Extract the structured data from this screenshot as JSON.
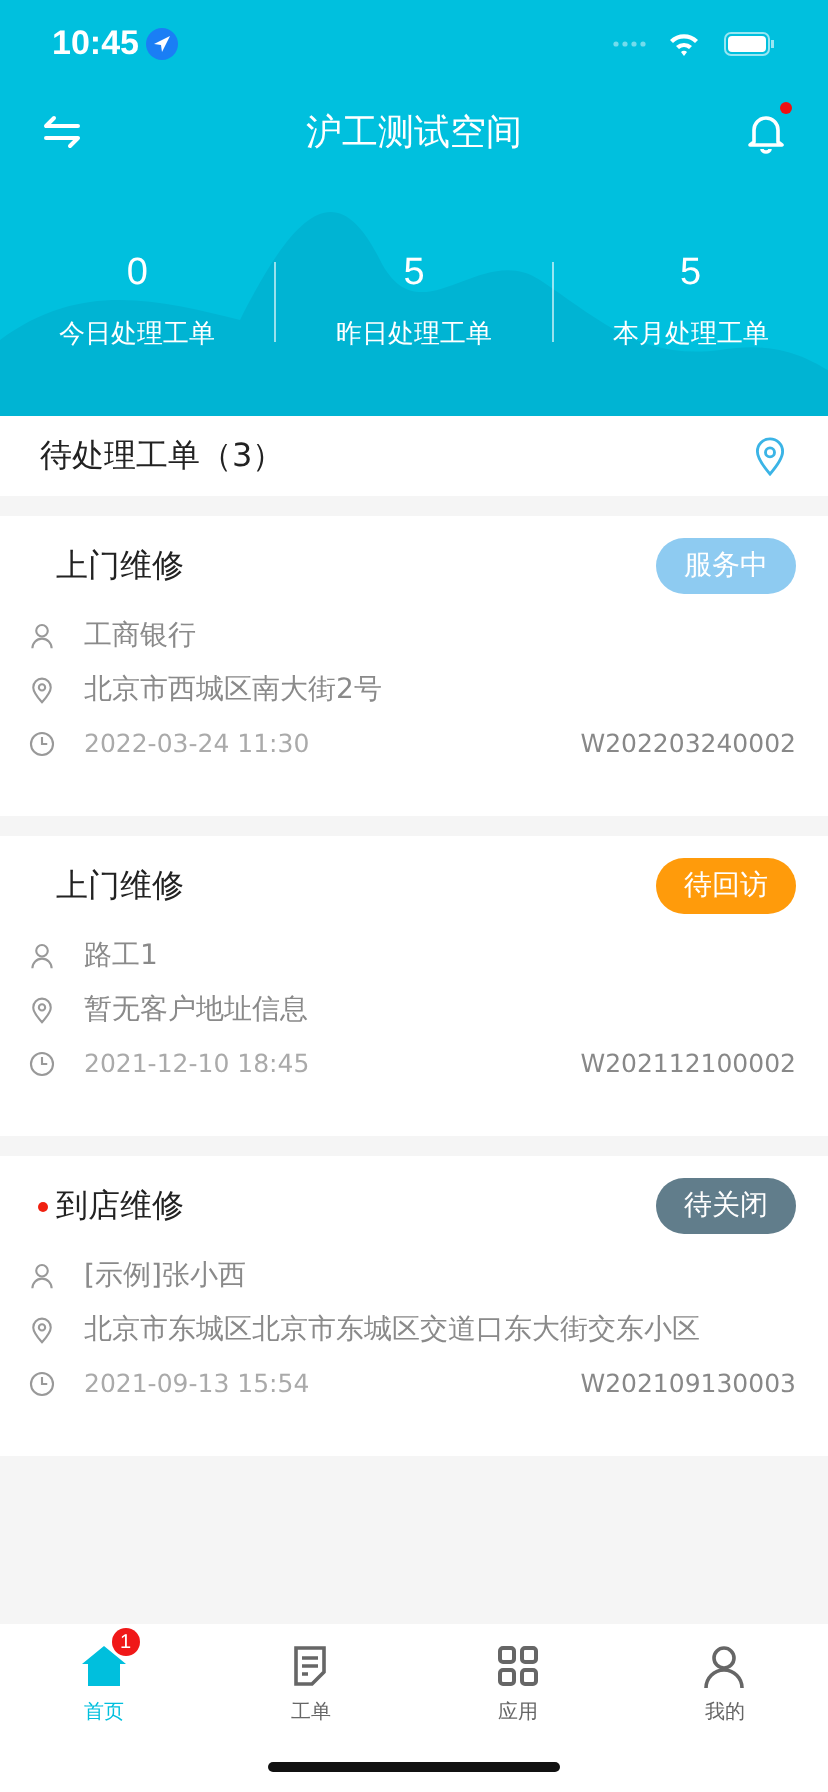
{
  "status_bar": {
    "time": "10:45"
  },
  "nav": {
    "title": "沪工测试空间",
    "has_notification": true
  },
  "stats": [
    {
      "value": "0",
      "label": "今日处理工单"
    },
    {
      "value": "5",
      "label": "昨日处理工单"
    },
    {
      "value": "5",
      "label": "本月处理工单"
    }
  ],
  "section": {
    "title": "待处理工单（3）"
  },
  "orders": [
    {
      "title": "上门维修",
      "unread": false,
      "status": "服务中",
      "color": "#8ecbf1",
      "customer": "工商银行",
      "address": "北京市西城区南大街2号",
      "time": "2022-03-24 11:30",
      "number": "W202203240002"
    },
    {
      "title": "上门维修",
      "unread": false,
      "status": "待回访",
      "color": "#ff9b0b",
      "customer": "路工1",
      "address": "暂无客户地址信息",
      "time": "2021-12-10 18:45",
      "number": "W202112100002"
    },
    {
      "title": "到店维修",
      "unread": true,
      "status": "待关闭",
      "color": "#617d8b",
      "customer": "[示例]张小西",
      "address": "北京市东城区北京市东城区交道口东大街交东小区",
      "time": "2021-09-13 15:54",
      "number": "W202109130003"
    }
  ],
  "tabs": [
    {
      "kind": "home",
      "label": "首页",
      "selected": true,
      "badge": "1"
    },
    {
      "kind": "orders",
      "label": "工单",
      "selected": false
    },
    {
      "kind": "apps",
      "label": "应用",
      "selected": false
    },
    {
      "kind": "user",
      "label": "我的",
      "selected": false
    }
  ]
}
